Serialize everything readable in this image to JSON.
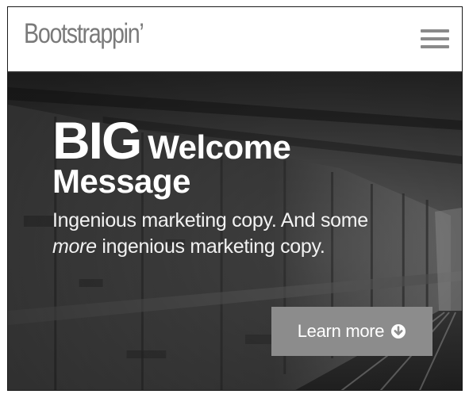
{
  "navbar": {
    "brand": "Bootstrappin’",
    "menu_icon": "hamburger-menu-icon"
  },
  "hero": {
    "headline_big": "BIG",
    "headline_welcome": "Welcome",
    "headline_message": "Message",
    "tagline_line1": "Ingenious marketing copy. And some",
    "tagline_em": "more",
    "tagline_rest": " ingenious marketing copy.",
    "cta_label": "Learn more",
    "cta_icon": "arrow-down-circle-icon",
    "background": "subway-tunnel-photo"
  }
}
